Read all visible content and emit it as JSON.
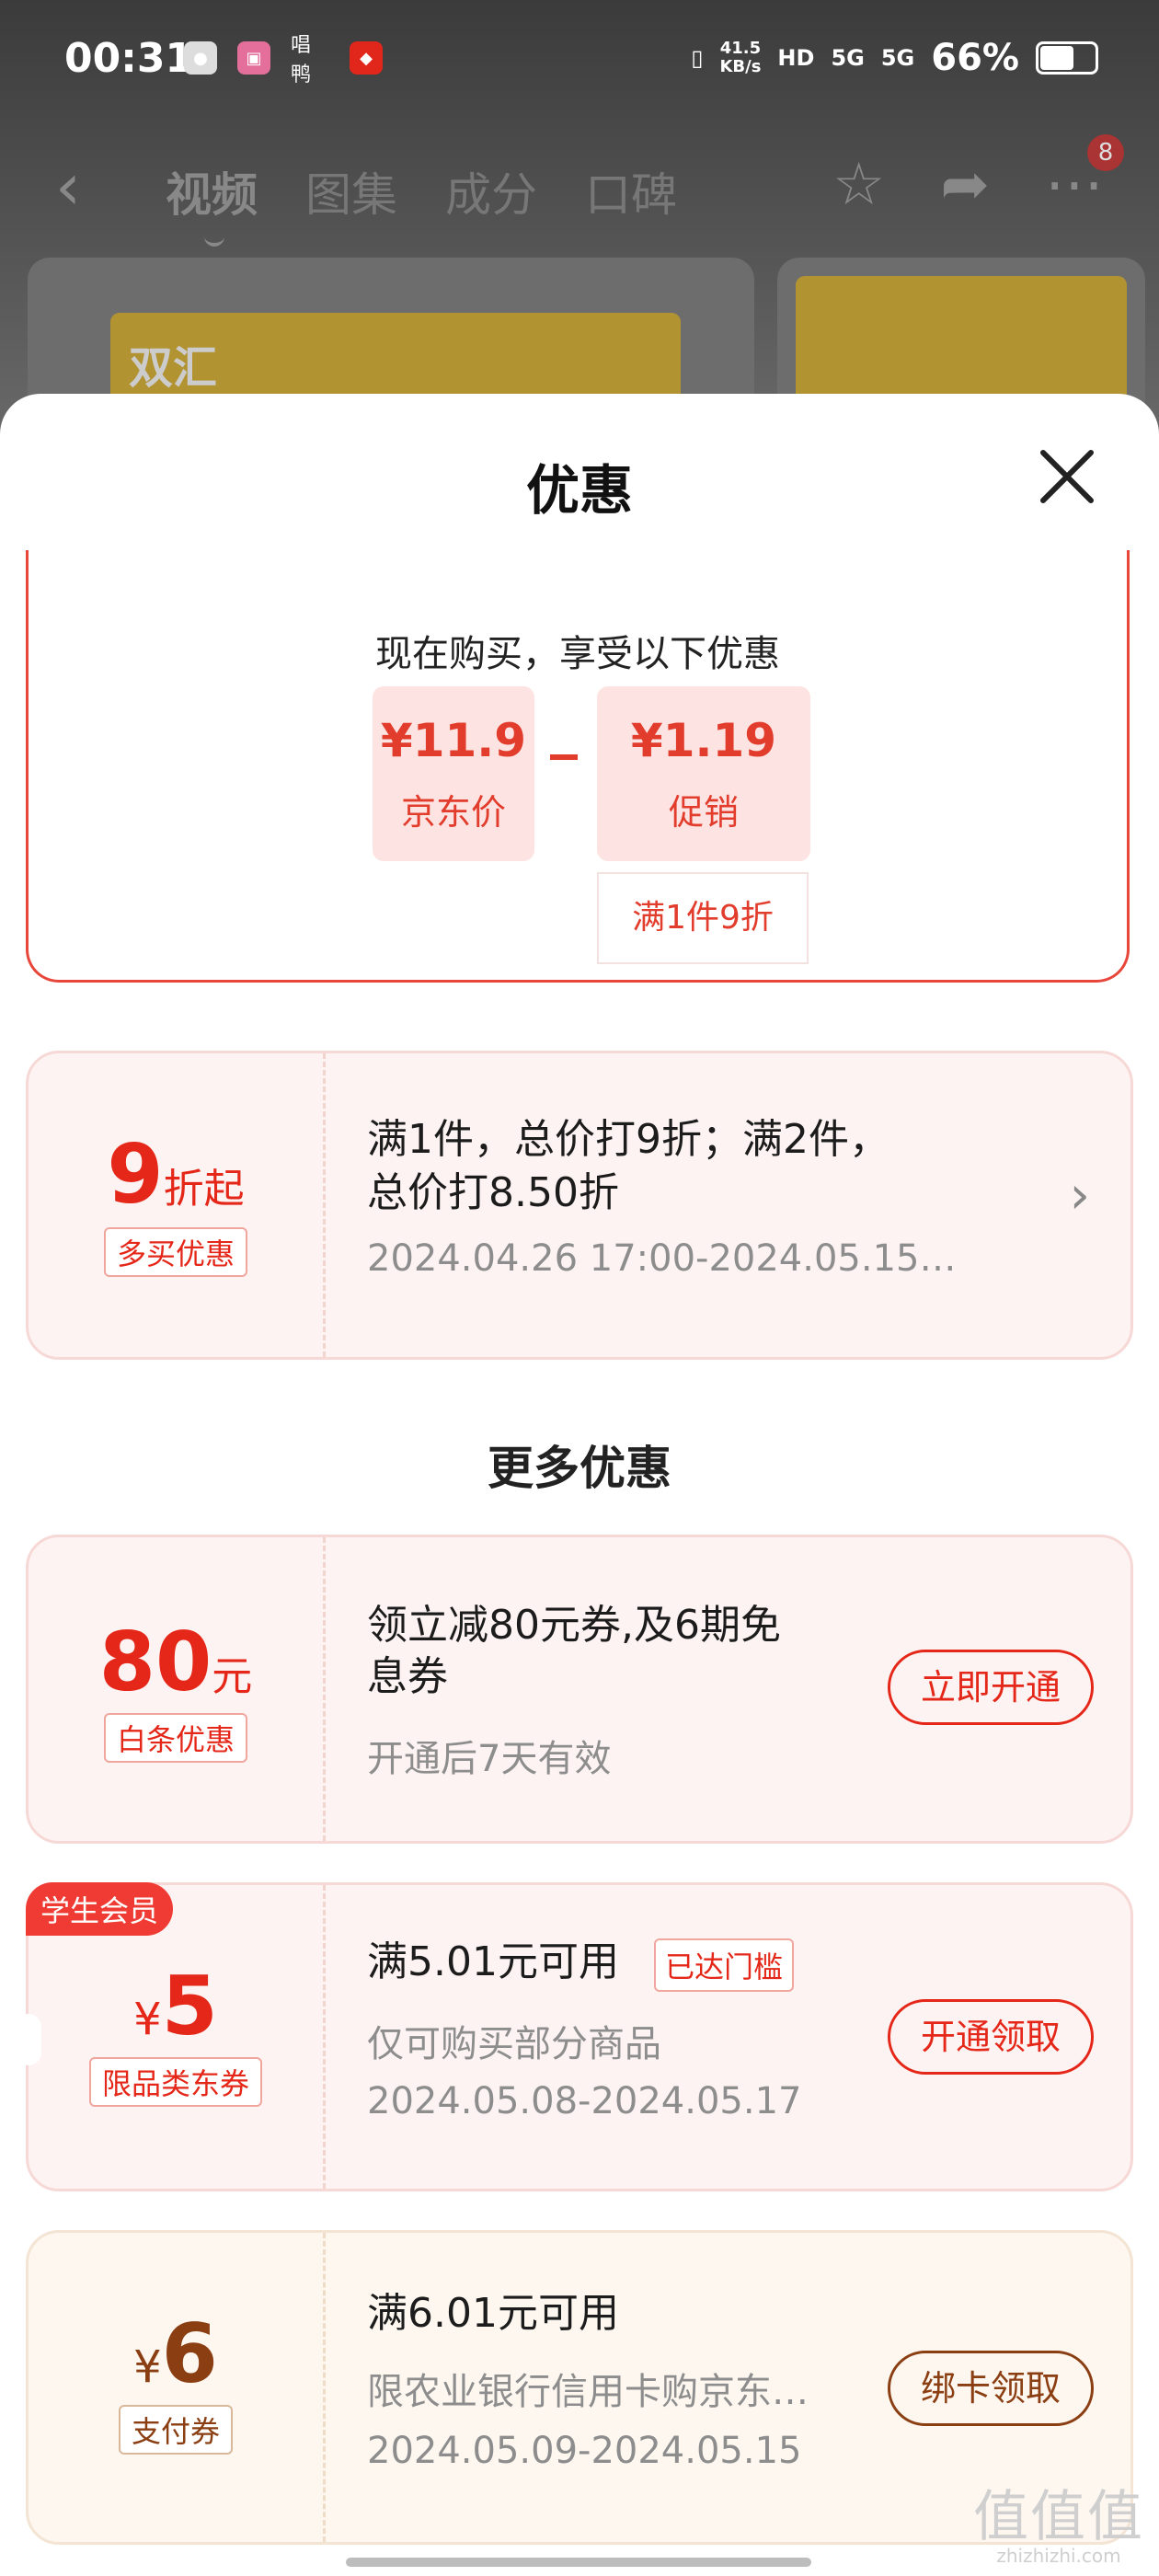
{
  "status_bar": {
    "time": "00:31",
    "net_speed_value": "41.5",
    "net_speed_unit": "KB/s",
    "hd_label": "HD",
    "signal_1": "5G",
    "signal_2": "5G",
    "battery": "66%",
    "battery_level": 0.66,
    "app3_label": "唱鸭"
  },
  "nav": {
    "tabs": [
      "视频",
      "图集",
      "成分",
      "口碑"
    ],
    "active_tab": "视频",
    "badge_count": "8",
    "back_icon": "back-arrow-icon",
    "favorite_icon": "star-icon",
    "share_icon": "share-icon",
    "more_icon": "more-dots-icon"
  },
  "background_products": {
    "brand_text": "双汇"
  },
  "sheet": {
    "title": "优惠",
    "close_icon": "close-icon"
  },
  "now_buy": {
    "title": "现在购买，享受以下优惠",
    "price": {
      "amount": "¥11.9",
      "label": "京东价"
    },
    "promo": {
      "amount": "¥1.19",
      "label": "促销",
      "condition": "满1件9折"
    }
  },
  "multi_buy": {
    "value": "9",
    "value_suffix": "折起",
    "tag": "多买优惠",
    "title_line1": "满1件，总价打9折；满2件，",
    "title_line2": "总价打8.50折",
    "period": "2024.04.26 17:00-2024.05.15…"
  },
  "more_section_title": "更多优惠",
  "coupons": [
    {
      "value": "80",
      "unit": "元",
      "tag": "白条优惠",
      "title_line1": "领立减80元券,及6期免",
      "title_line2": "息券",
      "sub": "开通后7天有效",
      "button": "立即开通"
    },
    {
      "badge": "学生会员",
      "currency": "¥",
      "value": "5",
      "tag": "限品类东券",
      "title": "满5.01元可用",
      "threshold": "已达门槛",
      "sub": "仅可购买部分商品",
      "period": "2024.05.08-2024.05.17",
      "button": "开通领取"
    },
    {
      "currency": "¥",
      "value": "6",
      "tag": "支付券",
      "title": "满6.01元可用",
      "sub": "限农业银行信用卡购京东…",
      "period": "2024.05.09-2024.05.15",
      "button": "绑卡领取"
    }
  ],
  "watermark": {
    "logo": "值值值",
    "url": "zhizhizhi.com"
  },
  "colors": {
    "accent_red": "#e42718",
    "gold_brown": "#8a3e12",
    "coupon_bg": "#fdf3f2"
  }
}
